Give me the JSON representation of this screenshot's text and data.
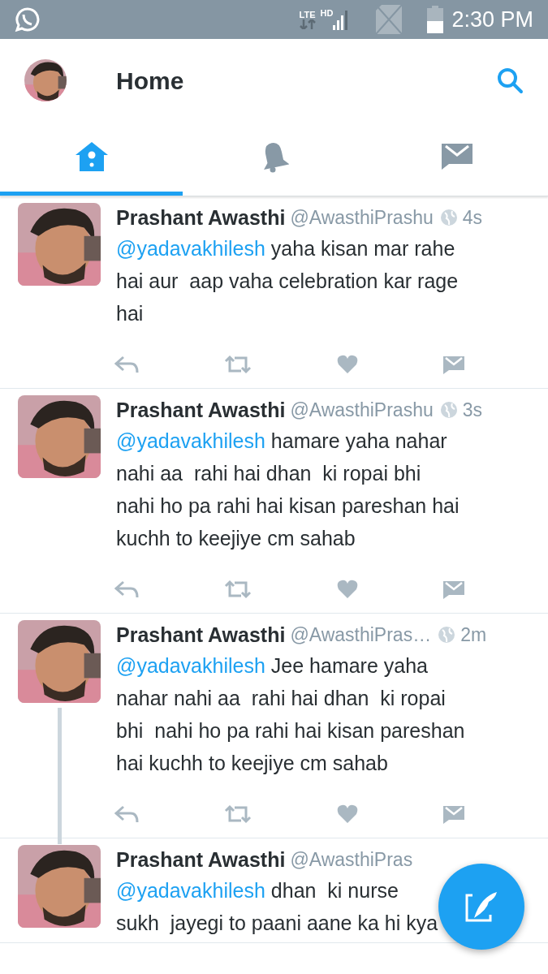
{
  "status_bar": {
    "network": "LTE",
    "quality": "HD",
    "time": "2:30 PM"
  },
  "header": {
    "title": "Home"
  },
  "tabs": [
    {
      "kind": "home",
      "selected": true
    },
    {
      "kind": "notifications",
      "selected": false
    },
    {
      "kind": "messages",
      "selected": false
    }
  ],
  "tweets": [
    {
      "name": "Prashant Awasthi",
      "handle": "@AwasthiPrashu",
      "time": "4s",
      "mention": "@yadavakhilesh",
      "lines": [
        "yaha kisan mar rahe",
        "hai aur  aap vaha celebration kar rage",
        "hai"
      ],
      "thread": false,
      "actions": true
    },
    {
      "name": "Prashant Awasthi",
      "handle": "@AwasthiPrashu",
      "time": "3s",
      "mention": "@yadavakhilesh",
      "lines": [
        "hamare yaha nahar",
        "nahi aa  rahi hai dhan  ki ropai bhi",
        "nahi ho pa rahi hai kisan pareshan hai",
        "kuchh to keejiye cm sahab"
      ],
      "thread": false,
      "actions": true
    },
    {
      "name": "Prashant Awasthi",
      "handle": "@AwasthiPras…",
      "time": "2m",
      "mention": "@yadavakhilesh",
      "lines": [
        "Jee hamare yaha",
        "nahar nahi aa  rahi hai dhan  ki ropai",
        "bhi  nahi ho pa rahi hai kisan pareshan",
        "hai kuchh to keejiye cm sahab"
      ],
      "thread": true,
      "actions": true
    },
    {
      "name": "Prashant Awasthi",
      "handle": "@AwasthiPras",
      "mention": "@yadavakhilesh",
      "lines": [
        "dhan  ki nurse",
        "sukh  jayegi to paani aane ka hi kya"
      ],
      "thread": false,
      "actions": false
    }
  ]
}
